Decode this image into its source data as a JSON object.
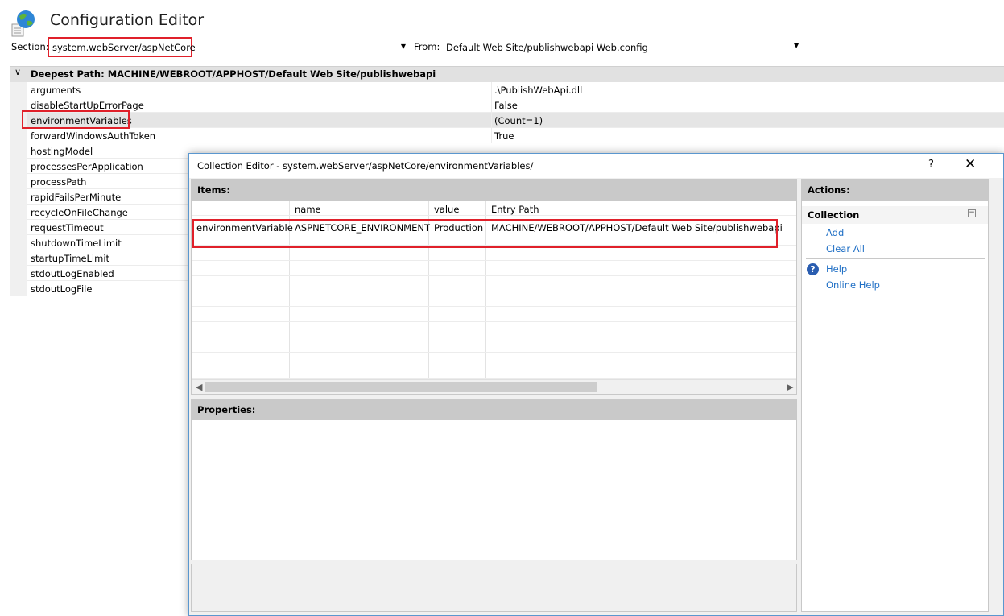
{
  "header": {
    "title": "Configuration Editor",
    "icon": "globe-config-icon"
  },
  "section": {
    "label": "Section:",
    "value": "system.webServer/aspNetCore"
  },
  "from": {
    "label": "From:",
    "value": "Default Web Site/publishwebapi Web.config"
  },
  "grid": {
    "deepest_path": "Deepest Path: MACHINE/WEBROOT/APPHOST/Default Web Site/publishwebapi",
    "rows": [
      {
        "name": "arguments",
        "value": ".\\PublishWebApi.dll"
      },
      {
        "name": "disableStartUpErrorPage",
        "value": "False"
      },
      {
        "name": "environmentVariables",
        "value": "(Count=1)"
      },
      {
        "name": "forwardWindowsAuthToken",
        "value": "True"
      },
      {
        "name": "hostingModel",
        "value": ""
      },
      {
        "name": "processesPerApplication",
        "value": ""
      },
      {
        "name": "processPath",
        "value": ""
      },
      {
        "name": "rapidFailsPerMinute",
        "value": ""
      },
      {
        "name": "recycleOnFileChange",
        "value": ""
      },
      {
        "name": "requestTimeout",
        "value": ""
      },
      {
        "name": "shutdownTimeLimit",
        "value": ""
      },
      {
        "name": "startupTimeLimit",
        "value": ""
      },
      {
        "name": "stdoutLogEnabled",
        "value": ""
      },
      {
        "name": "stdoutLogFile",
        "value": ""
      }
    ]
  },
  "dialog": {
    "title": "Collection Editor - system.webServer/aspNetCore/environmentVariables/",
    "help_glyph": "?",
    "close_glyph": "✕",
    "items_title": "Items:",
    "columns": [
      "",
      "name",
      "value",
      "Entry Path"
    ],
    "rows": [
      {
        "type": "environmentVariable",
        "name": "ASPNETCORE_ENVIRONMENT",
        "value": "Production",
        "entry_path": "MACHINE/WEBROOT/APPHOST/Default Web Site/publishwebapi"
      }
    ],
    "properties_title": "Properties:",
    "actions_title": "Actions:",
    "collection_group": "Collection",
    "actions": {
      "add": "Add",
      "clear_all": "Clear All",
      "help": "Help",
      "online_help": "Online Help"
    }
  },
  "colors": {
    "highlight": "#e0202a",
    "link": "#1f6fc5",
    "panel_header": "#c9c9c9",
    "dialog_border": "#5a97cf"
  }
}
